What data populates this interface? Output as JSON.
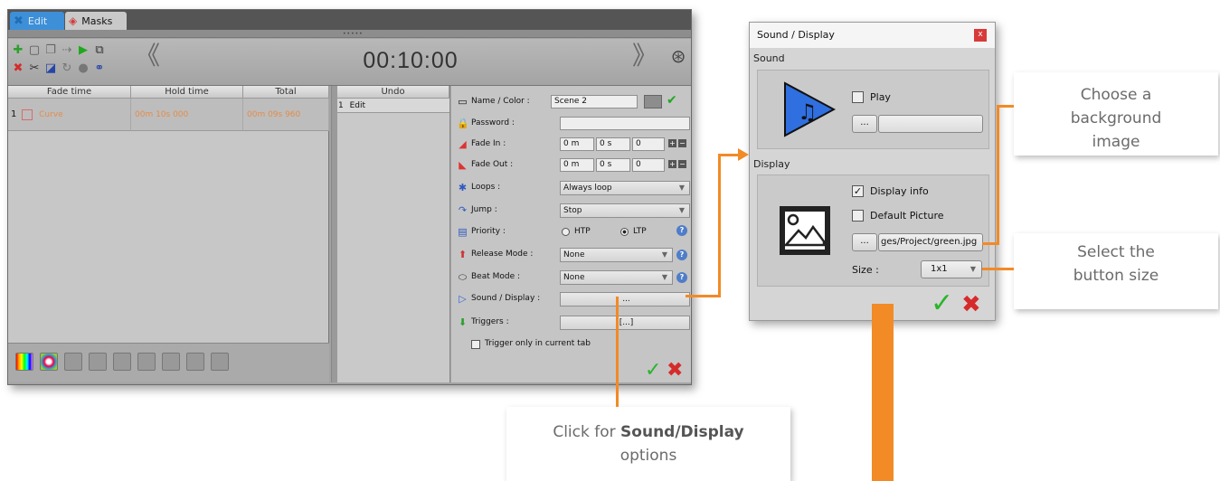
{
  "main": {
    "tabs": [
      {
        "label": "Edit"
      },
      {
        "label": "Masks"
      }
    ],
    "time": "00:10:00",
    "table": {
      "headers": [
        "Fade time",
        "Hold time",
        "Total"
      ],
      "rows": [
        {
          "index": "1",
          "name": "Curve",
          "hold": "00m 10s 000",
          "total": "00m 09s 960"
        }
      ]
    },
    "undo": {
      "header": "Undo",
      "rows": [
        {
          "index": "1",
          "label": "Edit"
        }
      ]
    },
    "props": {
      "name_label": "Name / Color :",
      "name_value": "Scene 2",
      "password_label": "Password :",
      "fadein_label": "Fade In :",
      "fadein_m": "0 m",
      "fadein_s": "0 s",
      "fadein_ms": "0",
      "fadeout_label": "Fade Out :",
      "fadeout_m": "0 m",
      "fadeout_s": "0 s",
      "fadeout_ms": "0",
      "loops_label": "Loops :",
      "loops_value": "Always loop",
      "jump_label": "Jump :",
      "jump_value": "Stop",
      "priority_label": "Priority :",
      "priority_htp": "HTP",
      "priority_ltp": "LTP",
      "priority_selected": "LTP",
      "release_label": "Release Mode :",
      "release_value": "None",
      "beat_label": "Beat Mode :",
      "beat_value": "None",
      "sound_label": "Sound / Display :",
      "sound_button": "...",
      "triggers_label": "Triggers :",
      "triggers_button": "[...]",
      "trigger_only": "Trigger only in current tab"
    }
  },
  "dialog": {
    "title": "Sound / Display",
    "close": "x",
    "sound_group": "Sound",
    "play_label": "Play",
    "browse_sound": "...",
    "display_group": "Display",
    "display_info_label": "Display info",
    "default_picture_label": "Default Picture",
    "browse_image": "...",
    "image_path": "ges/Project/green.jpg",
    "size_label": "Size :",
    "size_value": "1x1"
  },
  "callouts": {
    "background": "Choose a background image",
    "size": "Select the button size",
    "click_prefix": "Click for ",
    "click_bold": "Sound/Display",
    "click_suffix": "options"
  },
  "colors": {
    "accent": "#f28a26",
    "tab_active": "#3d8fd8",
    "orange_text": "#e38c4a"
  }
}
